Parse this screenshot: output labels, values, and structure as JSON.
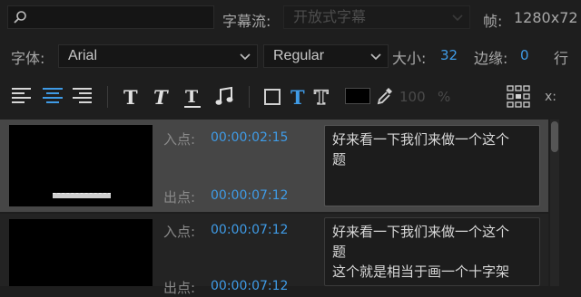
{
  "top": {
    "stream_label": "字幕流:",
    "stream_value": "开放式字幕",
    "frame_label": "帧:",
    "frame_value": "1280x72"
  },
  "font_row": {
    "font_label": "字体:",
    "font_value": "Arial",
    "style_value": "Regular",
    "size_label": "大小:",
    "size_value": "32",
    "edge_label": "边缘:",
    "edge_value": "0",
    "trailing_glyph": "行"
  },
  "toolbar": {
    "opacity_value": "100",
    "opacity_unit": "%",
    "x_label": "x:"
  },
  "captions": [
    {
      "in_label": "入点:",
      "in_tc": "00:00:02:15",
      "out_label": "出点:",
      "out_tc": "00:00:07:12",
      "text": "好来看一下我们来做一个这个\n题"
    },
    {
      "in_label": "入点:",
      "in_tc": "00:00:07:12",
      "out_label": "出点:",
      "out_tc": "00:00:07:12",
      "text": "好来看一下我们来做一个这个\n题\n这个就是相当于画一个十字架"
    }
  ],
  "colors": {
    "accent": "#3f9be6",
    "panel_bg": "#1e1e1e",
    "selected_row": "#464646"
  }
}
